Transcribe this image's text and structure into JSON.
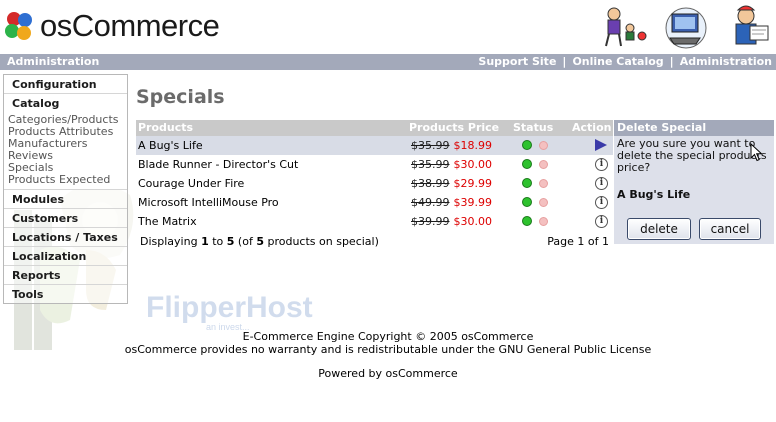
{
  "header": {
    "logo_text": "osCommerce",
    "icon": "oscommerce-logo-icon",
    "figures_icon": "header-illustration-icon"
  },
  "topbar": {
    "left": "Administration",
    "links": [
      "Support Site",
      "Online Catalog",
      "Administration"
    ],
    "separator": "|",
    "bg_color": "#a3a9ba"
  },
  "watermark": {
    "brand": "FlipperHost",
    "tagline": "an invest..."
  },
  "menu": {
    "configuration": "Configuration",
    "catalog": "Catalog",
    "catalog_items": [
      "Categories/Products",
      "Products Attributes",
      "Manufacturers",
      "Reviews",
      "Specials",
      "Products Expected"
    ],
    "modules": "Modules",
    "customers": "Customers",
    "locations": "Locations / Taxes",
    "localization": "Localization",
    "reports": "Reports",
    "tools": "Tools"
  },
  "main": {
    "title": "Specials",
    "columns": {
      "products": "Products",
      "price": "Products Price",
      "status": "Status",
      "action": "Action"
    },
    "rows": [
      {
        "name": "A Bug's Life",
        "old_price": "$35.99",
        "new_price": "$18.99",
        "action_icon": "arrow-right-icon"
      },
      {
        "name": "Blade Runner - Director's Cut",
        "old_price": "$35.99",
        "new_price": "$30.00",
        "action_icon": "info-icon"
      },
      {
        "name": "Courage Under Fire",
        "old_price": "$38.99",
        "new_price": "$29.99",
        "action_icon": "info-icon"
      },
      {
        "name": "Microsoft IntelliMouse Pro",
        "old_price": "$49.99",
        "new_price": "$39.99",
        "action_icon": "info-icon"
      },
      {
        "name": "The Matrix",
        "old_price": "$39.99",
        "new_price": "$30.00",
        "action_icon": "info-icon"
      }
    ],
    "displaying": {
      "prefix": "Displaying",
      "from": "1",
      "to_word": "to",
      "to": "5",
      "of_prefix": "(of",
      "total": "5",
      "suffix": "products on special)"
    },
    "page_info": "Page 1 of 1"
  },
  "delete_panel": {
    "title": "Delete Special",
    "question": "Are you sure you want to delete the special products price?",
    "product": "A Bug's Life",
    "delete_label": "delete",
    "cancel_label": "cancel"
  },
  "footer": {
    "line1": "E-Commerce Engine Copyright © 2005 osCommerce",
    "line2": "osCommerce provides no warranty and is redistributable under the GNU General Public License",
    "powered": "Powered by osCommerce"
  }
}
